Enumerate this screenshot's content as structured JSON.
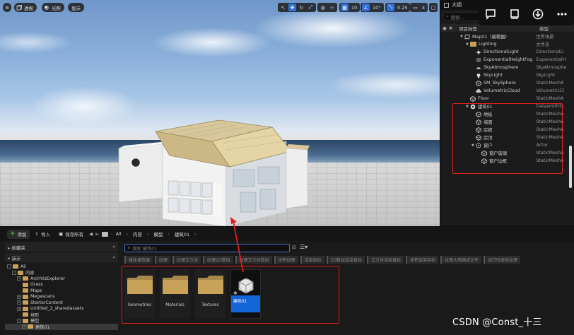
{
  "viewport": {
    "perspective_label": "透视",
    "lit_label": "光照",
    "show_label": "显示",
    "grid_snap_value": "10",
    "rotate_snap_value": "10°",
    "scale_snap_value": "0.25",
    "camera_speed_value": "4"
  },
  "outliner": {
    "tab_title": "大纲",
    "search_placeholder": "搜索...",
    "col_label": "项目标签",
    "col_type": "类型",
    "rows": [
      {
        "name": "Map01（编辑器）",
        "type": "世界场景",
        "depth": 1,
        "icon": "map",
        "expand": "open"
      },
      {
        "name": "Lighting",
        "type": "文件夹",
        "depth": 2,
        "icon": "folder",
        "expand": "open"
      },
      {
        "name": "DirectionalLight",
        "type": "DirectionalLi",
        "depth": 3,
        "icon": "sun"
      },
      {
        "name": "ExponentialHeightFog",
        "type": "ExponentialH",
        "depth": 3,
        "icon": "fog"
      },
      {
        "name": "SkyAtmosphere",
        "type": "SkyAtmosphe",
        "depth": 3,
        "icon": "sky"
      },
      {
        "name": "SkyLight",
        "type": "SkyLight",
        "depth": 3,
        "icon": "light"
      },
      {
        "name": "SM_SkySphere",
        "type": "StaticMeshA",
        "depth": 3,
        "icon": "mesh"
      },
      {
        "name": "VolumetricCloud",
        "type": "VolumetricCl",
        "depth": 3,
        "icon": "cloud"
      },
      {
        "name": "Floor",
        "type": "StaticMeshA",
        "depth": 2,
        "icon": "mesh"
      },
      {
        "name": "建筑01",
        "type": "DatasmithSc",
        "depth": 2,
        "icon": "scene",
        "expand": "open"
      },
      {
        "name": "地板",
        "type": "StaticMeshA",
        "depth": 3,
        "icon": "mesh"
      },
      {
        "name": "墙面",
        "type": "StaticMeshA",
        "depth": 3,
        "icon": "mesh"
      },
      {
        "name": "房檐",
        "type": "StaticMeshA",
        "depth": 3,
        "icon": "mesh"
      },
      {
        "name": "房顶",
        "type": "StaticMeshA",
        "depth": 3,
        "icon": "mesh"
      },
      {
        "name": "窗户",
        "type": "Actor",
        "depth": 3,
        "icon": "actor",
        "expand": "open"
      },
      {
        "name": "窗户玻璃",
        "type": "StaticMeshA",
        "depth": 4,
        "icon": "mesh"
      },
      {
        "name": "窗户边框",
        "type": "StaticMeshA",
        "depth": 4,
        "icon": "mesh"
      }
    ]
  },
  "content_browser": {
    "add_label": "添加",
    "import_label": "导入",
    "save_all_label": "保存所有",
    "breadcrumbs": [
      "All",
      "内容",
      "模型",
      "建筑01"
    ],
    "favorites_label": "收藏夹",
    "project_label": "演示",
    "search_placeholder": "搜索 建筑01",
    "tree": [
      {
        "label": "All",
        "depth": 0,
        "box": "-"
      },
      {
        "label": "内容",
        "depth": 1,
        "box": "-"
      },
      {
        "label": "ArchVizExplorer",
        "depth": 2,
        "box": "+"
      },
      {
        "label": "Grass",
        "depth": 2,
        "box": ""
      },
      {
        "label": "Maps",
        "depth": 2,
        "box": ""
      },
      {
        "label": "Megascans",
        "depth": 2,
        "box": "+"
      },
      {
        "label": "StarterContent",
        "depth": 2,
        "box": "+"
      },
      {
        "label": "Untitled_2_sharedassets",
        "depth": 2,
        "box": "+"
      },
      {
        "label": "地形",
        "depth": 2,
        "box": ""
      },
      {
        "label": "模型",
        "depth": 2,
        "box": "-"
      },
      {
        "label": "建筑01",
        "depth": 3,
        "box": "+",
        "selected": true
      }
    ],
    "filters": [
      "媒体播放器",
      "纹理",
      "纹理立方体",
      "纹理2D数组",
      "纹理立方体数组",
      "体积纹理",
      "渲染目标",
      "2D数组渲染目标",
      "立方体渲染目标",
      "体积渲染目标",
      "纹理大用描述文件",
      "运行时虚拟纹理"
    ],
    "assets": [
      {
        "label": "Geometries",
        "kind": "folder"
      },
      {
        "label": "Materials",
        "kind": "folder"
      },
      {
        "label": "Textures",
        "kind": "folder"
      },
      {
        "label": "建筑01",
        "kind": "scene",
        "selected": true
      }
    ]
  },
  "watermark": "CSDN @Const_十三",
  "colors": {
    "selection_blue": "#1466d8",
    "highlight_red": "#e02020",
    "folder_tan": "#c9a25a",
    "add_green": "#4caf50"
  }
}
